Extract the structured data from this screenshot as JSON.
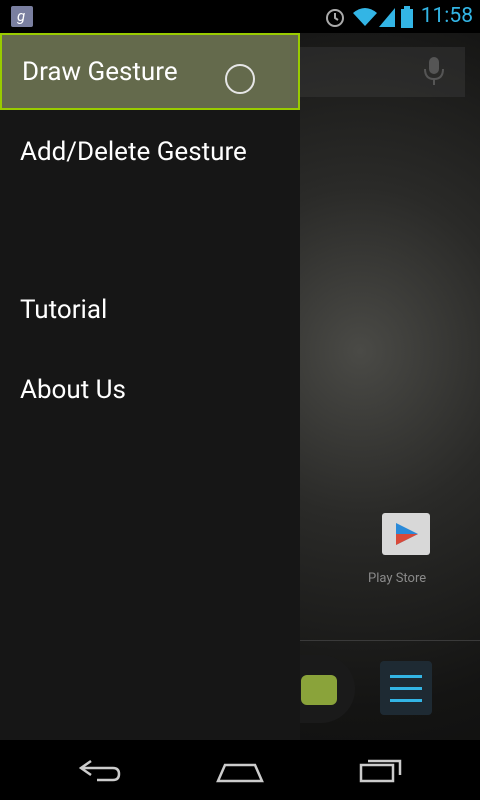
{
  "status_bar": {
    "time": "11:58"
  },
  "drawer": {
    "items": [
      {
        "label": "Draw Gesture"
      },
      {
        "label": "Add/Delete Gesture"
      },
      {
        "label": "Tutorial"
      },
      {
        "label": "About Us"
      }
    ]
  },
  "home": {
    "playstore_label": "Play Store"
  },
  "colors": {
    "accent": "#99cc00",
    "clock": "#33b5e5",
    "selected_bg": "#646a4c"
  }
}
